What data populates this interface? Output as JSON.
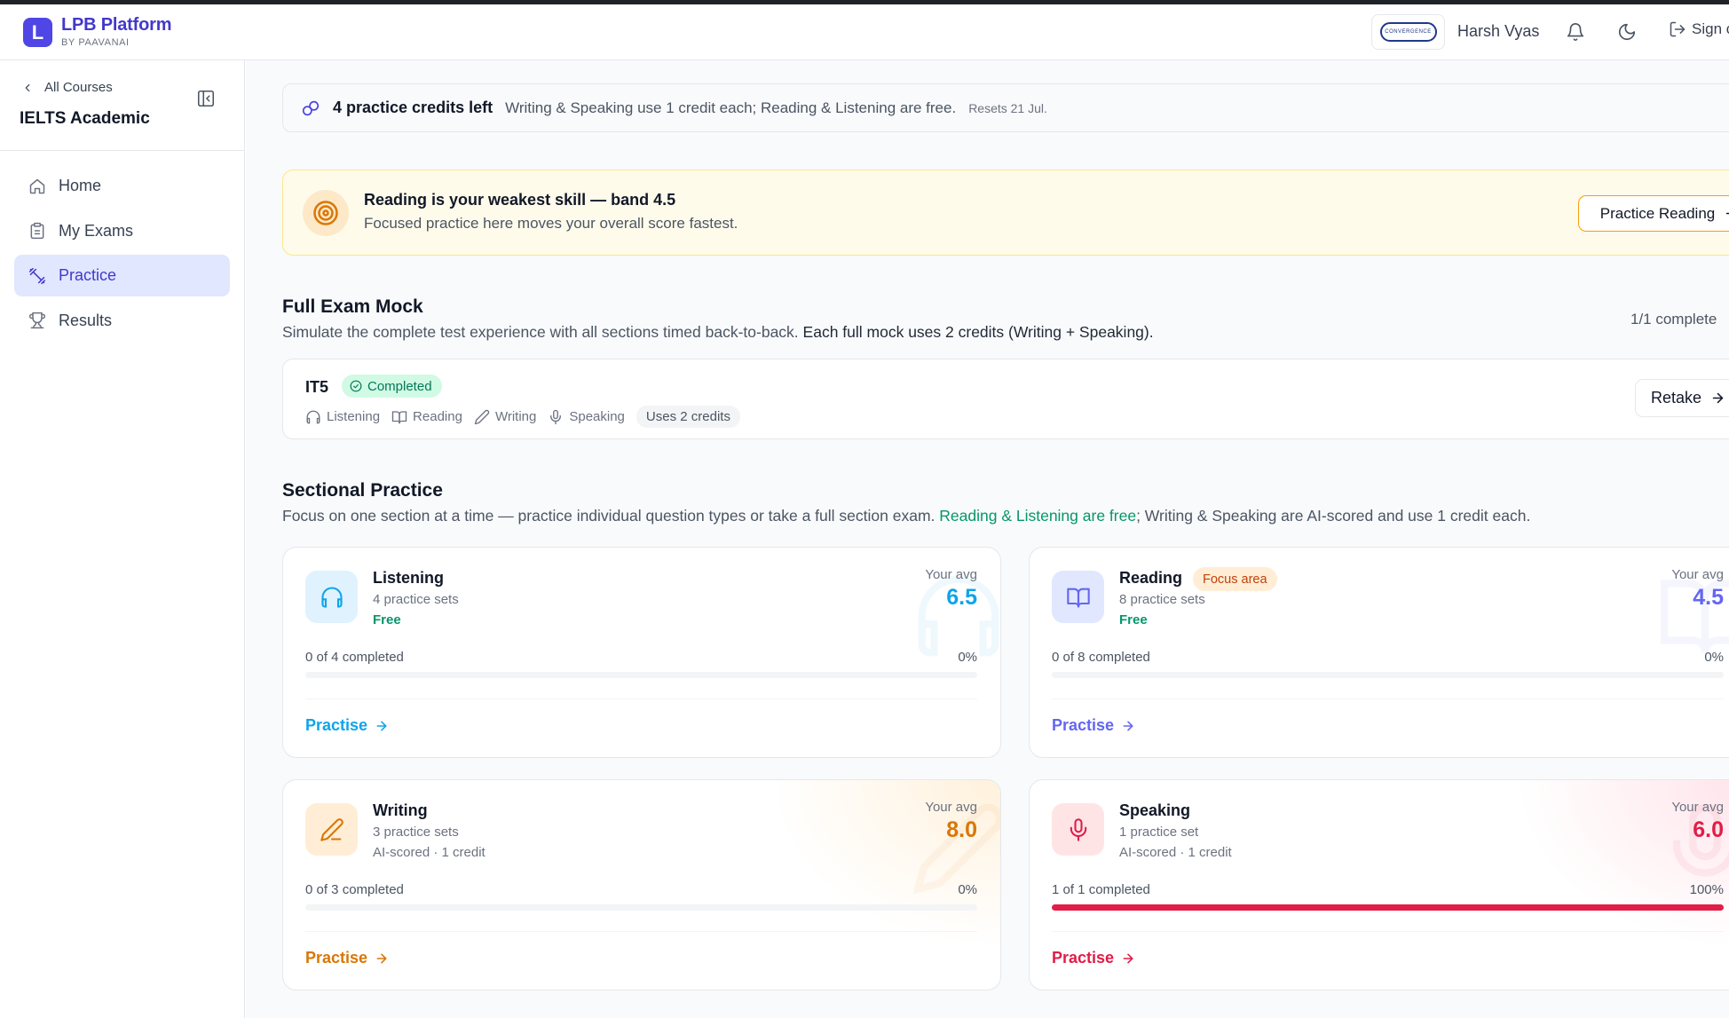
{
  "header": {
    "brand_title": "LPB Platform",
    "brand_sub": "BY PAAVANAI",
    "logo_letter": "L",
    "org_logo_text": "CONVERGENCE",
    "user_name": "Harsh Vyas",
    "signout_label": "Sign o"
  },
  "sidebar": {
    "back_label": "All Courses",
    "course_title": "IELTS Academic",
    "items": [
      {
        "label": "Home",
        "icon": "home-icon"
      },
      {
        "label": "My Exams",
        "icon": "clipboard-icon"
      },
      {
        "label": "Practice",
        "icon": "dumbbell-icon",
        "active": true
      },
      {
        "label": "Results",
        "icon": "trophy-icon"
      }
    ]
  },
  "credits": {
    "count_text": "4 practice credits left",
    "desc": "Writing & Speaking use 1 credit each; Reading & Listening are free.",
    "reset": "Resets 21 Jul."
  },
  "weakest": {
    "title": "Reading is your weakest skill — band 4.5",
    "subtitle": "Focused practice here moves your overall score fastest.",
    "button": "Practice Reading"
  },
  "mock": {
    "title": "Full Exam Mock",
    "subtitle_a": "Simulate the complete test experience with all sections timed back-to-back.",
    "subtitle_b": "Each full mock uses 2 credits (Writing + Speaking).",
    "count": "1/1 complete",
    "exam": {
      "code": "IT5",
      "status": "Completed",
      "sections": [
        "Listening",
        "Reading",
        "Writing",
        "Speaking"
      ],
      "credits_pill": "Uses 2 credits",
      "button": "Retake"
    }
  },
  "sectional": {
    "title": "Sectional Practice",
    "subtitle_a": "Focus on one section at a time — practice individual question types or take a full section exam.",
    "subtitle_green": "Reading & Listening are free",
    "subtitle_b": "; Writing & Speaking are AI-scored and use 1 credit each.",
    "avg_label": "Your avg",
    "cta": "Practise",
    "cards": [
      {
        "name": "Listening",
        "sets": "4 practice sets",
        "tag": "Free",
        "avg": "6.5",
        "completed": "0 of 4 completed",
        "pct": "0%",
        "progress": 0,
        "color": "#0ea5e9",
        "tint": "#e0f2fe",
        "tag_color": "#059669",
        "icon": "headphones-icon"
      },
      {
        "name": "Reading",
        "badge": "Focus area",
        "sets": "8 practice sets",
        "tag": "Free",
        "avg": "4.5",
        "completed": "0 of 8 completed",
        "pct": "0%",
        "progress": 0,
        "color": "#6366f1",
        "tint": "#e0e7ff",
        "tag_color": "#059669",
        "icon": "book-open-icon"
      },
      {
        "name": "Writing",
        "sets": "3 practice sets",
        "tag": "AI-scored · 1 credit",
        "avg": "8.0",
        "completed": "0 of 3 completed",
        "pct": "0%",
        "progress": 0,
        "color": "#d97706",
        "tint": "#ffedd5",
        "tag_color": "#6b7280",
        "icon": "pencil-icon"
      },
      {
        "name": "Speaking",
        "sets": "1 practice set",
        "tag": "AI-scored · 1 credit",
        "avg": "6.0",
        "completed": "1 of 1 completed",
        "pct": "100%",
        "progress": 1,
        "color": "#e11d48",
        "tint": "#ffe4e6",
        "tag_color": "#6b7280",
        "icon": "microphone-icon"
      }
    ]
  }
}
